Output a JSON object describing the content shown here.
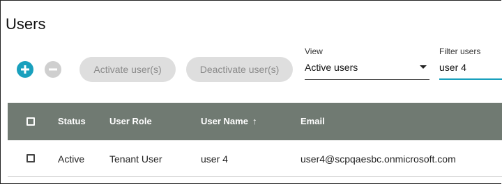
{
  "page": {
    "title": "Users"
  },
  "toolbar": {
    "add_icon": "plus-circle-icon",
    "remove_icon": "minus-circle-icon",
    "activate_label": "Activate user(s)",
    "deactivate_label": "Deactivate user(s)",
    "accent_color": "#19a0bd"
  },
  "view": {
    "label": "View",
    "selected": "Active users"
  },
  "filter": {
    "label": "Filter users",
    "value": "user 4"
  },
  "table": {
    "header_color": "#707a72",
    "columns": [
      "Status",
      "User Role",
      "User Name",
      "Email"
    ],
    "sort": {
      "column": "User Name",
      "direction": "↑"
    },
    "rows": [
      {
        "status": "Active",
        "role": "Tenant User",
        "name": "user 4",
        "email": "user4@scpqaesbc.onmicrosoft.com"
      }
    ]
  }
}
